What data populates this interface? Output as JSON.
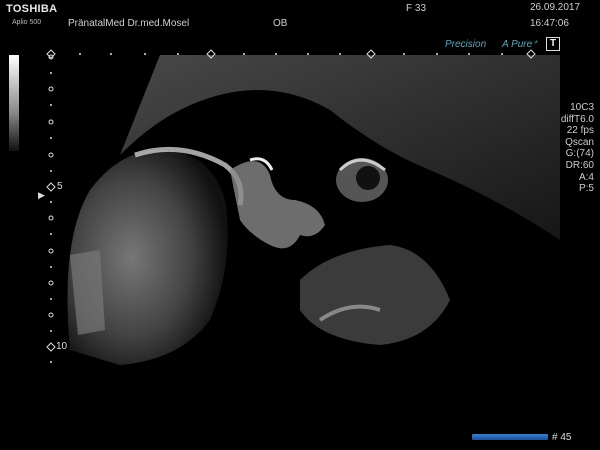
{
  "header": {
    "brand": "TOSHIBA",
    "model": "Aplio 500",
    "institution": "PränatalMed Dr.med.Mosel",
    "preset": "OB",
    "frequency": "F  33",
    "date": "26.09.2017",
    "time": "16:47:06"
  },
  "modes": {
    "precision": "Precision",
    "apure": "A Pure⁺",
    "t_box": "T"
  },
  "params": [
    "10C3",
    "diffT6.0",
    "22 fps",
    "Qscan",
    "G:(74)",
    "DR:60",
    "A:4",
    "P:5"
  ],
  "depth_scale": {
    "label_5": "5",
    "label_10": "10"
  },
  "footer": {
    "frame_label": "# 45",
    "progress": 0.92
  },
  "colors": {
    "accent": "#5fa6b8",
    "bar": "#2a66b8"
  },
  "icons": {
    "focus_marker": "triangle-right-icon"
  }
}
